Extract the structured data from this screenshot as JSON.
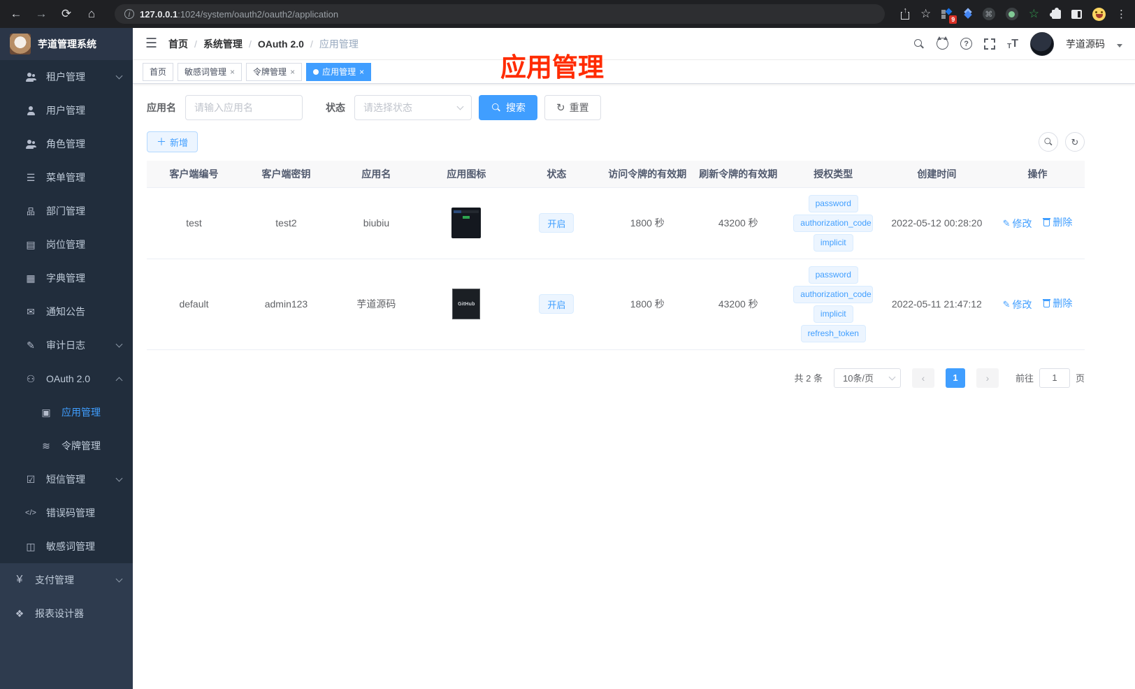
{
  "browser": {
    "url_host": "127.0.0.1",
    "url_rest": ":1024/system/oauth2/oauth2/application",
    "extension_badge": "9"
  },
  "sidebar": {
    "app_title": "芋道管理系统",
    "items": [
      {
        "label": "租户管理"
      },
      {
        "label": "用户管理"
      },
      {
        "label": "角色管理"
      },
      {
        "label": "菜单管理"
      },
      {
        "label": "部门管理"
      },
      {
        "label": "岗位管理"
      },
      {
        "label": "字典管理"
      },
      {
        "label": "通知公告"
      },
      {
        "label": "审计日志"
      },
      {
        "label": "OAuth 2.0"
      },
      {
        "label": "应用管理"
      },
      {
        "label": "令牌管理"
      },
      {
        "label": "短信管理"
      },
      {
        "label": "错误码管理"
      },
      {
        "label": "敏感词管理"
      },
      {
        "label": "支付管理"
      },
      {
        "label": "报表设计器"
      }
    ]
  },
  "header": {
    "breadcrumb": [
      "首页",
      "系统管理",
      "OAuth 2.0",
      "应用管理"
    ],
    "username": "芋道源码",
    "annotation": "应用管理"
  },
  "tabs": [
    {
      "label": "首页"
    },
    {
      "label": "敏感词管理"
    },
    {
      "label": "令牌管理"
    },
    {
      "label": "应用管理"
    }
  ],
  "filters": {
    "name_label": "应用名",
    "name_placeholder": "请输入应用名",
    "status_label": "状态",
    "status_placeholder": "请选择状态",
    "search_label": "搜索",
    "reset_label": "重置"
  },
  "toolbar": {
    "add_label": "新增"
  },
  "table": {
    "headers": [
      "客户端编号",
      "客户端密钥",
      "应用名",
      "应用图标",
      "状态",
      "访问令牌的有效期",
      "刷新令牌的有效期",
      "授权类型",
      "创建时间",
      "操作"
    ],
    "actions": {
      "edit": "修改",
      "delete": "删除"
    },
    "rows": [
      {
        "client_id": "test",
        "secret": "test2",
        "name": "biubiu",
        "status": "开启",
        "access_ttl": "1800 秒",
        "refresh_ttl": "43200 秒",
        "grants": [
          "password",
          "authorization_code",
          "implicit"
        ],
        "created": "2022-05-12 00:28:20"
      },
      {
        "client_id": "default",
        "secret": "admin123",
        "name": "芋道源码",
        "icon_text": "GitHub",
        "status": "开启",
        "access_ttl": "1800 秒",
        "refresh_ttl": "43200 秒",
        "grants": [
          "password",
          "authorization_code",
          "implicit",
          "refresh_token"
        ],
        "created": "2022-05-11 21:47:12"
      }
    ]
  },
  "pagination": {
    "total_label": "共 2 条",
    "page_size_label": "10条/页",
    "current_page": "1",
    "goto_label": "前往",
    "goto_value": "1",
    "unit_label": "页"
  },
  "colors": {
    "accent": "#409eff",
    "annotation_red": "#ff2b00",
    "sidebar_bg": "#2e3b4e",
    "submenu_bg": "#212d3c"
  }
}
